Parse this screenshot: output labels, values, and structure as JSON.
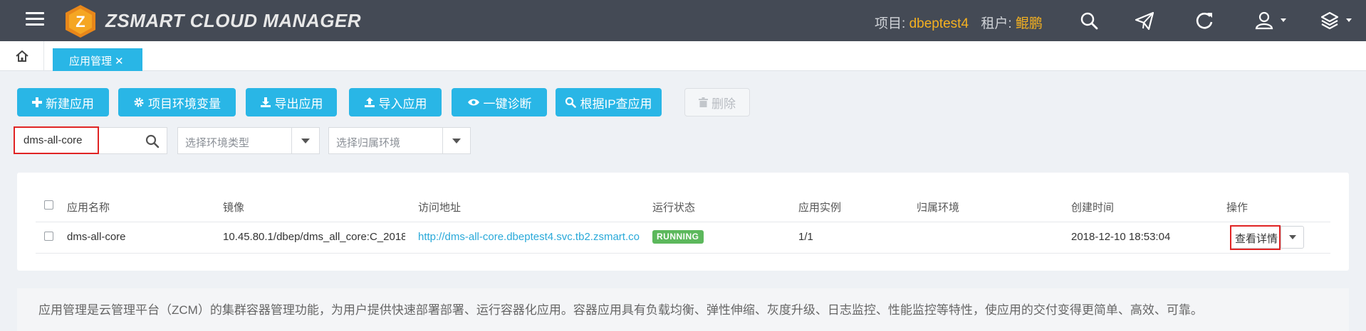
{
  "header": {
    "brand": "ZSMART CLOUD MANAGER",
    "logo_letter": "Z",
    "project_label": "项目: ",
    "project_value": "dbeptest4",
    "tenant_label": "租户: ",
    "tenant_value": "鲲鹏",
    "icons": [
      "menu-icon",
      "search-icon",
      "send-icon",
      "refresh-icon",
      "user-icon",
      "layers-icon"
    ]
  },
  "tabs": {
    "active_label": "应用管理",
    "close_glyph": "✕"
  },
  "toolbar": {
    "new_app": "新建应用",
    "env_vars": "项目环境变量",
    "export": "导出应用",
    "import": "导入应用",
    "diagnose": "一键诊断",
    "by_ip": "根据IP查应用",
    "delete": "删除"
  },
  "filters": {
    "search_value": "dms-all-core",
    "env_type_placeholder": "选择环境类型",
    "env_placeholder": "选择归属环境"
  },
  "table": {
    "headers": {
      "name": "应用名称",
      "image": "镜像",
      "address": "访问地址",
      "status": "运行状态",
      "instances": "应用实例",
      "env": "归属环境",
      "created": "创建时间",
      "ops": "操作"
    },
    "rows": [
      {
        "name": "dms-all-core",
        "image": "10.45.80.1/dbep/dms_all_core:C_2018",
        "address": "http://dms-all-core.dbeptest4.svc.tb2.zsmart.co",
        "status": "RUNNING",
        "instances": "1/1",
        "env": "",
        "created": "2018-12-10 18:53:04",
        "action": "查看详情"
      }
    ]
  },
  "info_text": "应用管理是云管理平台（ZCM）的集群容器管理功能，为用户提供快速部署部署、运行容器化应用。容器应用具有负载均衡、弹性伸缩、灰度升级、日志监控、性能监控等特性，使应用的交付变得更简单、高效、可靠。",
  "colors": {
    "navbar": "#444a55",
    "accent": "#29b6e6",
    "highlight": "#f5b120",
    "running": "#5cb85c",
    "annotation": "#e02424"
  }
}
